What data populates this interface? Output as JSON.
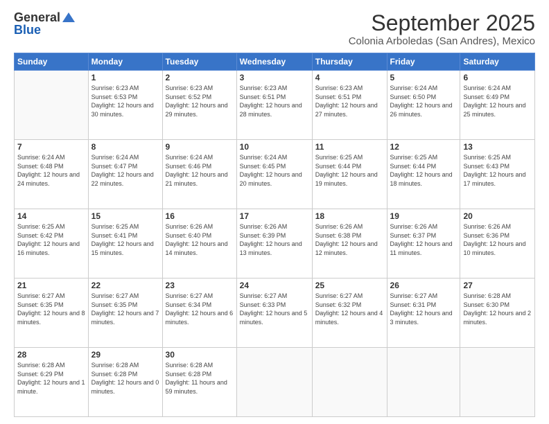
{
  "logo": {
    "general": "General",
    "blue": "Blue"
  },
  "title": "September 2025",
  "subtitle": "Colonia Arboledas (San Andres), Mexico",
  "headers": [
    "Sunday",
    "Monday",
    "Tuesday",
    "Wednesday",
    "Thursday",
    "Friday",
    "Saturday"
  ],
  "weeks": [
    [
      {
        "day": "",
        "sunrise": "",
        "sunset": "",
        "daylight": ""
      },
      {
        "day": "1",
        "sunrise": "Sunrise: 6:23 AM",
        "sunset": "Sunset: 6:53 PM",
        "daylight": "Daylight: 12 hours and 30 minutes."
      },
      {
        "day": "2",
        "sunrise": "Sunrise: 6:23 AM",
        "sunset": "Sunset: 6:52 PM",
        "daylight": "Daylight: 12 hours and 29 minutes."
      },
      {
        "day": "3",
        "sunrise": "Sunrise: 6:23 AM",
        "sunset": "Sunset: 6:51 PM",
        "daylight": "Daylight: 12 hours and 28 minutes."
      },
      {
        "day": "4",
        "sunrise": "Sunrise: 6:23 AM",
        "sunset": "Sunset: 6:51 PM",
        "daylight": "Daylight: 12 hours and 27 minutes."
      },
      {
        "day": "5",
        "sunrise": "Sunrise: 6:24 AM",
        "sunset": "Sunset: 6:50 PM",
        "daylight": "Daylight: 12 hours and 26 minutes."
      },
      {
        "day": "6",
        "sunrise": "Sunrise: 6:24 AM",
        "sunset": "Sunset: 6:49 PM",
        "daylight": "Daylight: 12 hours and 25 minutes."
      }
    ],
    [
      {
        "day": "7",
        "sunrise": "Sunrise: 6:24 AM",
        "sunset": "Sunset: 6:48 PM",
        "daylight": "Daylight: 12 hours and 24 minutes."
      },
      {
        "day": "8",
        "sunrise": "Sunrise: 6:24 AM",
        "sunset": "Sunset: 6:47 PM",
        "daylight": "Daylight: 12 hours and 22 minutes."
      },
      {
        "day": "9",
        "sunrise": "Sunrise: 6:24 AM",
        "sunset": "Sunset: 6:46 PM",
        "daylight": "Daylight: 12 hours and 21 minutes."
      },
      {
        "day": "10",
        "sunrise": "Sunrise: 6:24 AM",
        "sunset": "Sunset: 6:45 PM",
        "daylight": "Daylight: 12 hours and 20 minutes."
      },
      {
        "day": "11",
        "sunrise": "Sunrise: 6:25 AM",
        "sunset": "Sunset: 6:44 PM",
        "daylight": "Daylight: 12 hours and 19 minutes."
      },
      {
        "day": "12",
        "sunrise": "Sunrise: 6:25 AM",
        "sunset": "Sunset: 6:44 PM",
        "daylight": "Daylight: 12 hours and 18 minutes."
      },
      {
        "day": "13",
        "sunrise": "Sunrise: 6:25 AM",
        "sunset": "Sunset: 6:43 PM",
        "daylight": "Daylight: 12 hours and 17 minutes."
      }
    ],
    [
      {
        "day": "14",
        "sunrise": "Sunrise: 6:25 AM",
        "sunset": "Sunset: 6:42 PM",
        "daylight": "Daylight: 12 hours and 16 minutes."
      },
      {
        "day": "15",
        "sunrise": "Sunrise: 6:25 AM",
        "sunset": "Sunset: 6:41 PM",
        "daylight": "Daylight: 12 hours and 15 minutes."
      },
      {
        "day": "16",
        "sunrise": "Sunrise: 6:26 AM",
        "sunset": "Sunset: 6:40 PM",
        "daylight": "Daylight: 12 hours and 14 minutes."
      },
      {
        "day": "17",
        "sunrise": "Sunrise: 6:26 AM",
        "sunset": "Sunset: 6:39 PM",
        "daylight": "Daylight: 12 hours and 13 minutes."
      },
      {
        "day": "18",
        "sunrise": "Sunrise: 6:26 AM",
        "sunset": "Sunset: 6:38 PM",
        "daylight": "Daylight: 12 hours and 12 minutes."
      },
      {
        "day": "19",
        "sunrise": "Sunrise: 6:26 AM",
        "sunset": "Sunset: 6:37 PM",
        "daylight": "Daylight: 12 hours and 11 minutes."
      },
      {
        "day": "20",
        "sunrise": "Sunrise: 6:26 AM",
        "sunset": "Sunset: 6:36 PM",
        "daylight": "Daylight: 12 hours and 10 minutes."
      }
    ],
    [
      {
        "day": "21",
        "sunrise": "Sunrise: 6:27 AM",
        "sunset": "Sunset: 6:35 PM",
        "daylight": "Daylight: 12 hours and 8 minutes."
      },
      {
        "day": "22",
        "sunrise": "Sunrise: 6:27 AM",
        "sunset": "Sunset: 6:35 PM",
        "daylight": "Daylight: 12 hours and 7 minutes."
      },
      {
        "day": "23",
        "sunrise": "Sunrise: 6:27 AM",
        "sunset": "Sunset: 6:34 PM",
        "daylight": "Daylight: 12 hours and 6 minutes."
      },
      {
        "day": "24",
        "sunrise": "Sunrise: 6:27 AM",
        "sunset": "Sunset: 6:33 PM",
        "daylight": "Daylight: 12 hours and 5 minutes."
      },
      {
        "day": "25",
        "sunrise": "Sunrise: 6:27 AM",
        "sunset": "Sunset: 6:32 PM",
        "daylight": "Daylight: 12 hours and 4 minutes."
      },
      {
        "day": "26",
        "sunrise": "Sunrise: 6:27 AM",
        "sunset": "Sunset: 6:31 PM",
        "daylight": "Daylight: 12 hours and 3 minutes."
      },
      {
        "day": "27",
        "sunrise": "Sunrise: 6:28 AM",
        "sunset": "Sunset: 6:30 PM",
        "daylight": "Daylight: 12 hours and 2 minutes."
      }
    ],
    [
      {
        "day": "28",
        "sunrise": "Sunrise: 6:28 AM",
        "sunset": "Sunset: 6:29 PM",
        "daylight": "Daylight: 12 hours and 1 minute."
      },
      {
        "day": "29",
        "sunrise": "Sunrise: 6:28 AM",
        "sunset": "Sunset: 6:28 PM",
        "daylight": "Daylight: 12 hours and 0 minutes."
      },
      {
        "day": "30",
        "sunrise": "Sunrise: 6:28 AM",
        "sunset": "Sunset: 6:28 PM",
        "daylight": "Daylight: 11 hours and 59 minutes."
      },
      {
        "day": "",
        "sunrise": "",
        "sunset": "",
        "daylight": ""
      },
      {
        "day": "",
        "sunrise": "",
        "sunset": "",
        "daylight": ""
      },
      {
        "day": "",
        "sunrise": "",
        "sunset": "",
        "daylight": ""
      },
      {
        "day": "",
        "sunrise": "",
        "sunset": "",
        "daylight": ""
      }
    ]
  ]
}
